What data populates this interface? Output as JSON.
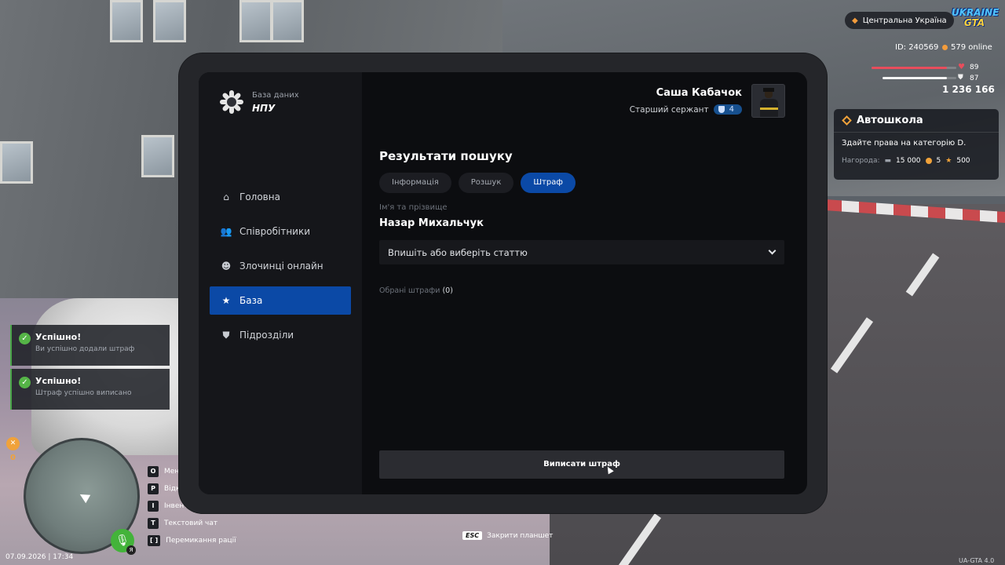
{
  "hud": {
    "region": "Центральна Україна",
    "logo_line1": "UKRAINE",
    "logo_line2": "GTA",
    "id_text": "ID: 240569",
    "online_text": "579 online",
    "health": 89,
    "armor": 87,
    "money": "1 236 166",
    "hunger_value": "0",
    "datetime": "07.09.2026 | 17:34",
    "version": "UA-GTA 4.0",
    "mic_tag": "Я"
  },
  "quest": {
    "title": "Автошкола",
    "description": "Здайте права на категорію D.",
    "reward_label": "Нагорода:",
    "reward_money": "15 000",
    "reward_coins": "5",
    "reward_stars": "500"
  },
  "toasts": [
    {
      "title": "Успішно!",
      "text": "Ви успішно додали штраф"
    },
    {
      "title": "Успішно!",
      "text": "Штраф успішно виписано"
    }
  ],
  "keys": [
    {
      "key": "O",
      "label": "Меню"
    },
    {
      "key": "P",
      "label": "Відкрити телефон"
    },
    {
      "key": "I",
      "label": "Інвентар"
    },
    {
      "key": "T",
      "label": "Текстовий чат"
    },
    {
      "key": "[ ]",
      "label": "Перемикання рації"
    }
  ],
  "esc_hint": {
    "key": "ESC",
    "label": "Закрити планшет"
  },
  "tablet": {
    "brand_sub": "База даних",
    "brand_name": "НПУ",
    "user": {
      "name": "Саша Кабачок",
      "rank": "Старший сержант",
      "rank_level": "4"
    },
    "nav": [
      {
        "label": "Головна",
        "icon": "home-icon",
        "active": false
      },
      {
        "label": "Співробітники",
        "icon": "users-icon",
        "active": false
      },
      {
        "label": "Злочинці онлайн",
        "icon": "criminal-icon",
        "active": false
      },
      {
        "label": "База",
        "icon": "star-icon",
        "active": true
      },
      {
        "label": "Підрозділи",
        "icon": "shield-icon",
        "active": false
      }
    ],
    "page_title": "Результати пошуку",
    "tabs": [
      {
        "label": "Інформація",
        "active": false
      },
      {
        "label": "Розшук",
        "active": false
      },
      {
        "label": "Штраф",
        "active": true
      }
    ],
    "name_label": "Ім'я та прізвище",
    "name_value": "Назар Михальчук",
    "article_select": {
      "placeholder": "Впишіть або виберіть статтю"
    },
    "selected_label": "Обрані штрафи",
    "selected_count": "(0)",
    "submit_label": "Виписати штраф"
  }
}
